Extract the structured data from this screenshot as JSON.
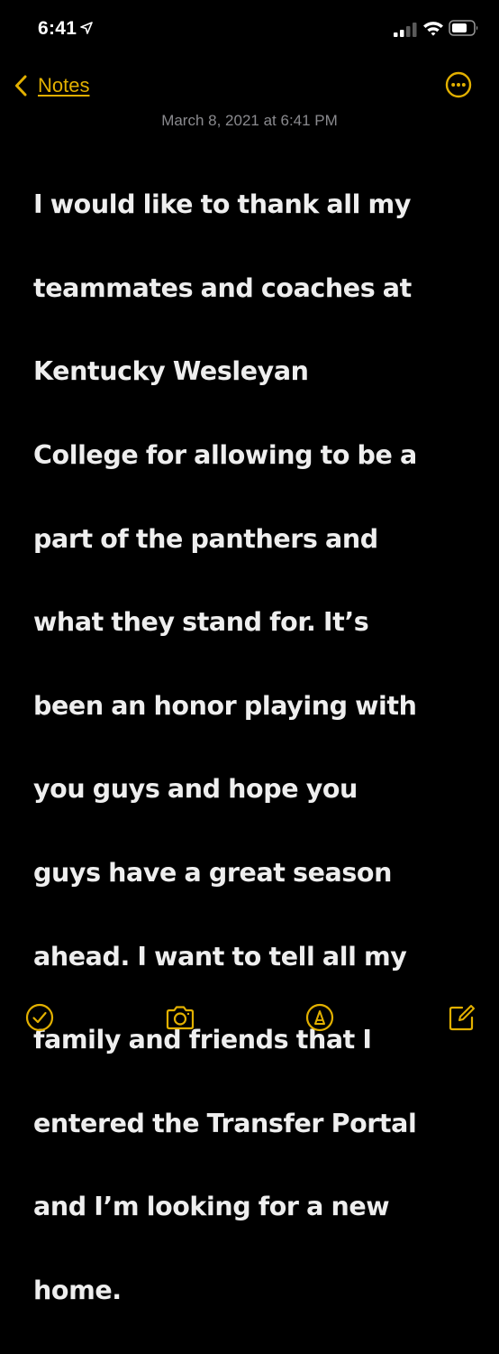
{
  "status_bar": {
    "time": "6:41",
    "icons": [
      "location-arrow-icon",
      "cellular-signal-icon",
      "wifi-icon",
      "battery-icon"
    ]
  },
  "nav": {
    "back_label": "Notes",
    "more_icon": "ellipsis-circle-icon"
  },
  "note": {
    "date": "March 8, 2021 at 6:41 PM",
    "lines": [
      "I would like to thank all my",
      "teammates and coaches at",
      "Kentucky Wesleyan",
      "College for allowing to be a",
      "part of the panthers and",
      "what they stand for. It’s",
      "been an honor playing with",
      "you guys and hope you",
      "guys have a great season",
      "ahead. I want to tell all my",
      "family and friends that I",
      "entered the Transfer Portal",
      "and I’m looking for a new",
      "home."
    ]
  },
  "toolbar": {
    "icons": [
      "checklist-icon",
      "camera-icon",
      "markup-pen-icon",
      "compose-icon"
    ]
  },
  "colors": {
    "accent": "#e2b000",
    "background": "#000000",
    "text": "#eeeeee",
    "secondary_text": "#8a8a8e"
  }
}
